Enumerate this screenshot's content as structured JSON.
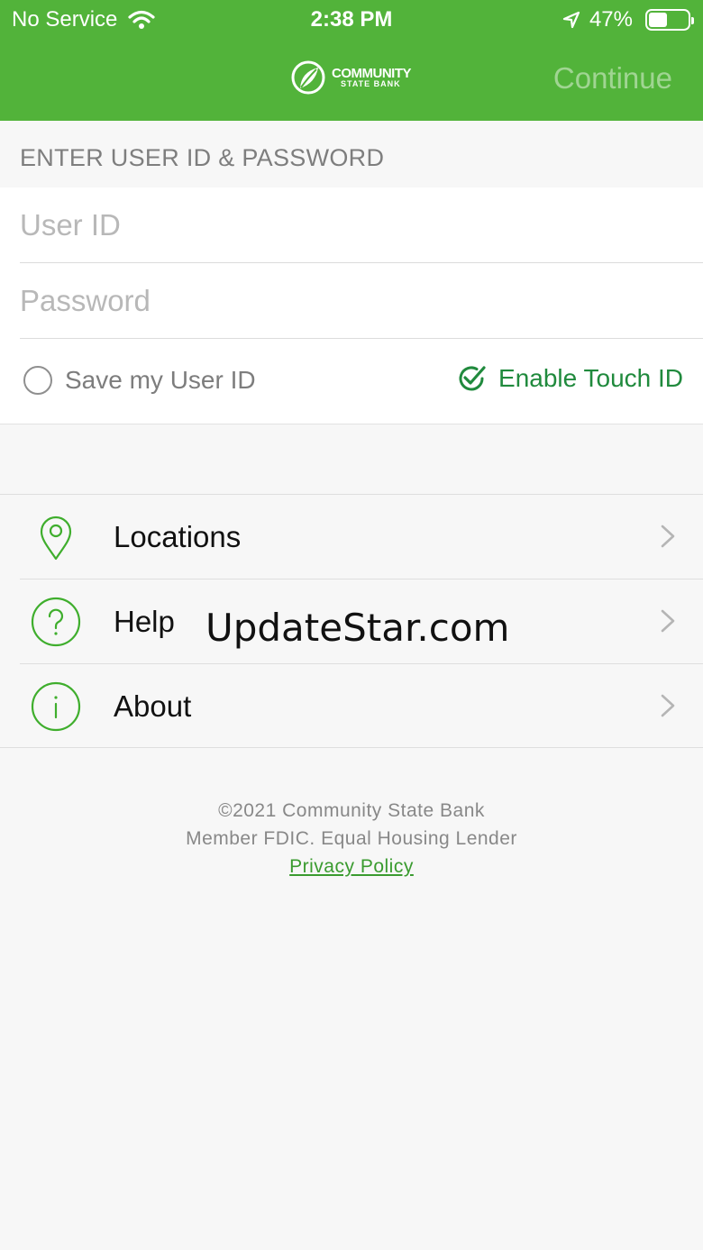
{
  "status_bar": {
    "carrier": "No Service",
    "time": "2:38 PM",
    "battery": "47%",
    "battery_level": 0.47
  },
  "nav": {
    "brand_line1": "COMMUNITY",
    "brand_line2": "STATE BANK",
    "continue_label": "Continue"
  },
  "login": {
    "section_title": "ENTER USER ID & PASSWORD",
    "user_id_placeholder": "User ID",
    "password_placeholder": "Password",
    "save_user_id_label": "Save my User ID",
    "touch_id_label": "Enable Touch ID"
  },
  "menu": {
    "items": [
      {
        "label": "Locations",
        "icon": "location-pin-icon"
      },
      {
        "label": "Help",
        "icon": "help-circle-icon"
      },
      {
        "label": "About",
        "icon": "info-circle-icon"
      }
    ]
  },
  "watermark": "UpdateStar.com",
  "footer": {
    "copyright": "©2021 Community State Bank",
    "fdic": "Member FDIC. Equal Housing Lender",
    "privacy_link": "Privacy Policy"
  },
  "colors": {
    "brand_green": "#52b33a",
    "accent_green": "#208a3d",
    "background": "#f7f7f7"
  }
}
